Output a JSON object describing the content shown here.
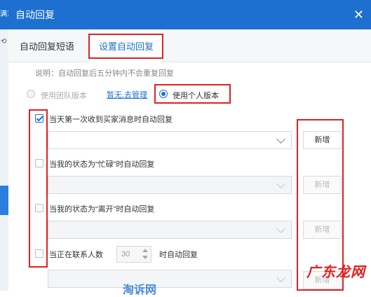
{
  "background_app": {
    "top_text": "满意"
  },
  "dialog": {
    "title": "自动回复",
    "close_glyph": "✕",
    "tabs": [
      {
        "label": "自动回复短语",
        "active": false
      },
      {
        "label": "设置自动回复",
        "active": true
      }
    ],
    "note": "说明：自动回复后五分钟内不会重复回复",
    "version": {
      "team_label": "使用团队版本",
      "team_link": "暂无,去管理",
      "personal_label": "使用个人版本",
      "selected": "personal"
    },
    "options": [
      {
        "label": "当天第一次收到买家消息时自动回复",
        "checked": true,
        "add_label": "新增",
        "enabled": true
      },
      {
        "label": "当我的状态为“忙碌”时自动回复",
        "checked": false,
        "add_label": "新增",
        "enabled": false
      },
      {
        "label": "当我的状态为“离开”时自动回复",
        "checked": false,
        "add_label": "新增",
        "enabled": false
      },
      {
        "label_prefix": "当正在联系人数",
        "stepper_value": "30",
        "label_suffix": "时自动回复",
        "checked": false,
        "add_label": "新增",
        "enabled": false
      }
    ]
  },
  "watermark": {
    "text": "广东龙网",
    "bottom_text": "淘诉网"
  },
  "colors": {
    "primary": "#1d6fd0",
    "annotation_red": "#e02020"
  }
}
